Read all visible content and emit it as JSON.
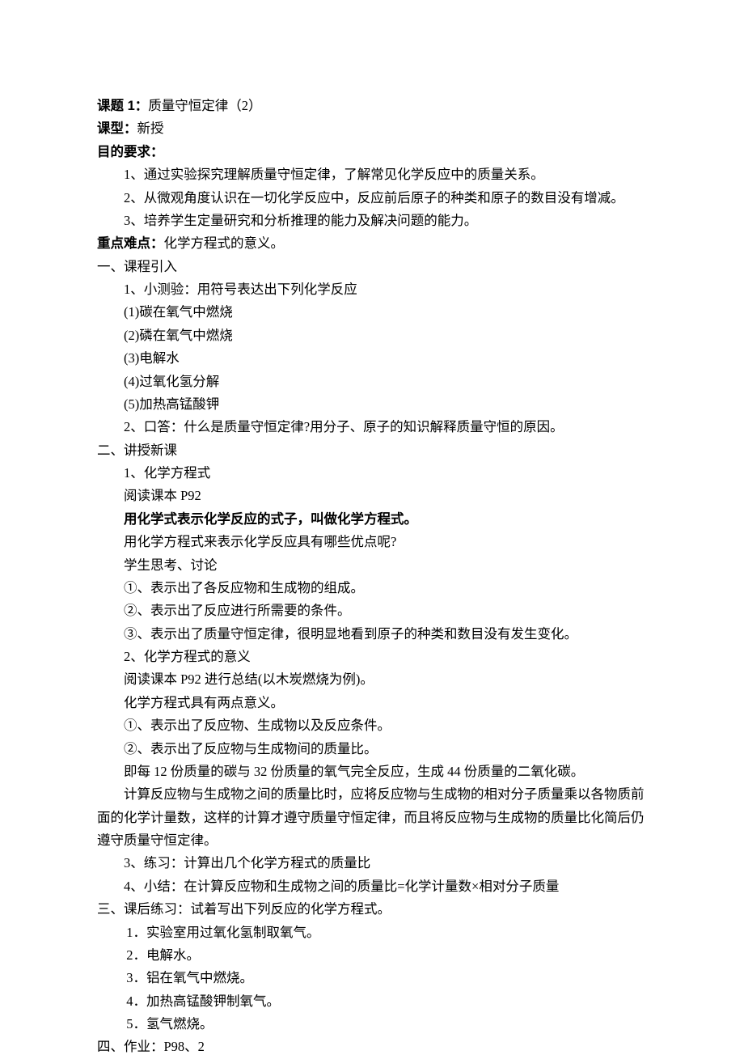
{
  "header": {
    "title_label": "课题 1：",
    "title_value": "质量守恒定律（2）",
    "type_label": "课型：",
    "type_value": "新授",
    "req_label": "目的要求：",
    "reqs": [
      "1、通过实验探究理解质量守恒定律，了解常见化学反应中的质量关系。",
      "2、从微观角度认识在一切化学反应中，反应前后原子的种类和原子的数目没有增减。",
      "3、培养学生定量研究和分析推理的能力及解决问题的能力。"
    ],
    "kd_label": "重点难点：",
    "kd_value": "化学方程式的意义。"
  },
  "s1": {
    "title": "一、课程引入",
    "quiz_title": "1、小测验：用符号表达出下列化学反应",
    "quiz_items": [
      "(1)碳在氧气中燃烧",
      "(2)磷在氧气中燃烧",
      "(3)电解水",
      "(4)过氧化氢分解",
      "(5)加热高锰酸钾"
    ],
    "oral": "2、口答：什么是质量守恒定律?用分子、原子的知识解释质量守恒的原因。"
  },
  "s2": {
    "title": "二、讲授新课",
    "p1": "1、化学方程式",
    "p1_read": "阅读课本 P92",
    "p1_def": "用化学式表示化学反应的式子，叫做化学方程式。",
    "p1_q": "用化学方程式来表示化学反应具有哪些优点呢?",
    "p1_think": "学生思考、讨论",
    "adv": [
      "①、表示出了各反应物和生成物的组成。",
      "②、表示出了反应进行所需要的条件。",
      "③、表示出了质量守恒定律，很明显地看到原子的种类和数目没有发生变化。"
    ],
    "p2": "2、化学方程式的意义",
    "p2_read": "阅读课本 P92 进行总结(以木炭燃烧为例)。",
    "p2_intro": "化学方程式具有两点意义。",
    "mean": [
      "①、表示出了反应物、生成物以及反应条件。",
      "②、表示出了反应物与生成物间的质量比。"
    ],
    "p2_ex": "即每 12 份质量的碳与 32 份质量的氧气完全反应，生成 44 份质量的二氧化碳。",
    "p2_calc": "计算反应物与生成物之间的质量比时，应将反应物与生成物的相对分子质量乘以各物质前面的化学计量数，这样的计算才遵守质量守恒定律，而且将反应物与生成物的质量比化简后仍遵守质量守恒定律。",
    "p3": "3、练习：计算出几个化学方程式的质量比",
    "p4": "4、小结：在计算反应物和生成物之间的质量比=化学计量数×相对分子质量"
  },
  "s3": {
    "title": "三、课后练习：试着写出下列反应的化学方程式。",
    "items": [
      "1．实验室用过氧化氢制取氧气。",
      "2．电解水。",
      "3．铝在氧气中燃烧。",
      "4．加热高锰酸钾制氧气。",
      "5．氢气燃烧。"
    ]
  },
  "s4": {
    "title": "四、作业：P98、2"
  }
}
